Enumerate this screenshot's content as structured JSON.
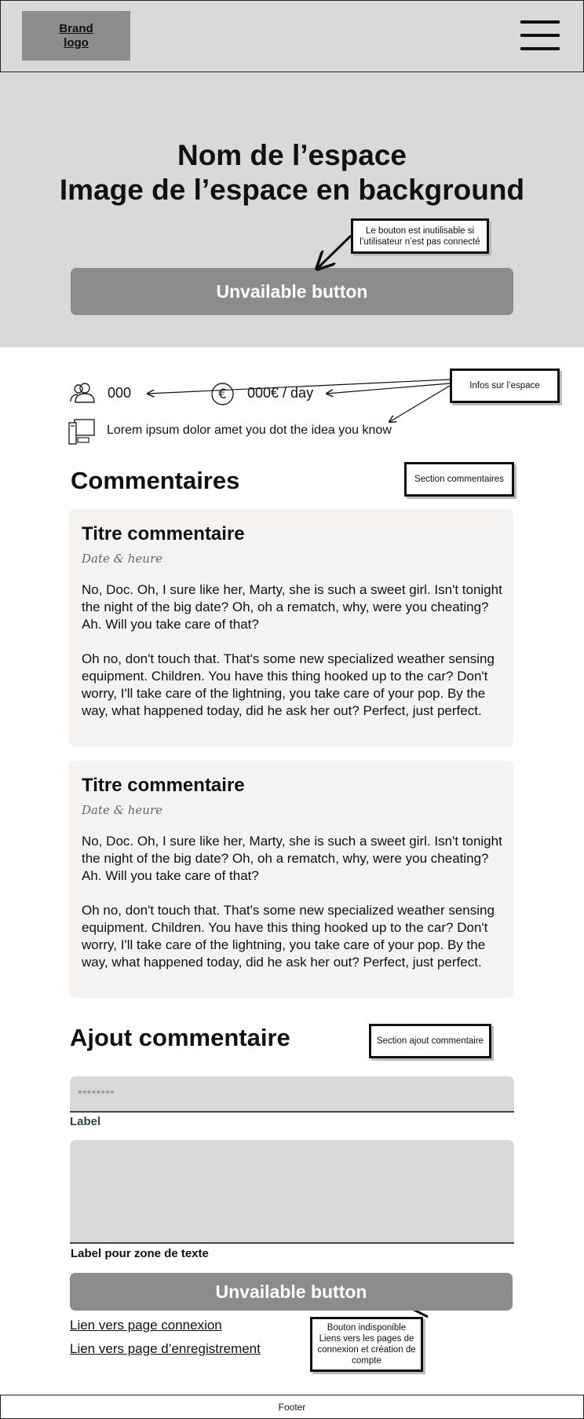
{
  "header": {
    "logo_line1": "Brand",
    "logo_line2": "logo",
    "menu_icon": "hamburger-menu-icon"
  },
  "hero": {
    "title_line1": "Nom de l’espace",
    "title_line2": "Image de l’espace en background",
    "button_label": "Unvailable button",
    "note": "Le bouton est inutilisable  si l’utilisateur n’est pas connecté"
  },
  "info": {
    "capacity": "000",
    "price": "000€ / day",
    "description": "Lorem ipsum dolor amet you dot the idea you know",
    "note": "Infos sur l’espace",
    "icons": [
      "users-icon",
      "euro-icon",
      "computer-icon"
    ]
  },
  "comments": {
    "title": "Commentaires",
    "note": "Section commentaires",
    "items": [
      {
        "title": "Titre commentaire",
        "date": "Date & heure",
        "p1": "No, Doc. Oh, I sure like her, Marty, she is such a sweet girl. Isn't tonight the night of the big date? Oh, oh a rematch, why, were you cheating? Ah. Will you take care of that?",
        "p2": "Oh no, don't touch that. That's some new specialized weather sensing equipment. Children. You have this thing hooked up to the car? Don't worry, I'll take care of the lightning, you take care of your pop. By the way, what happened today, did he ask her out? Perfect, just perfect."
      },
      {
        "title": "Titre commentaire",
        "date": "Date & heure",
        "p1": "No, Doc. Oh, I sure like her, Marty, she is such a sweet girl. Isn't tonight the night of the big date? Oh, oh a rematch, why, were you cheating? Ah. Will you take care of that?",
        "p2": "Oh no, don't touch that. That's some new specialized weather sensing equipment. Children. You have this thing hooked up to the car? Don't worry, I'll take care of the lightning, you take care of your pop. By the way, what happened today, did he ask her out? Perfect, just perfect."
      }
    ]
  },
  "add_comment": {
    "title": "Ajout commentaire",
    "note": "Section ajout commentaire",
    "input_placeholder": "********",
    "input_label": "Label",
    "textarea_label": "Label pour zone de texte",
    "button_label": "Unvailable button",
    "link_login": "Lien vers page connexion",
    "link_register": "Lien vers page d’enregistrement",
    "note_button": "Bouton indisponible Liens vers les pages de connexion et création de compte"
  },
  "footer": {
    "label": "Footer"
  }
}
